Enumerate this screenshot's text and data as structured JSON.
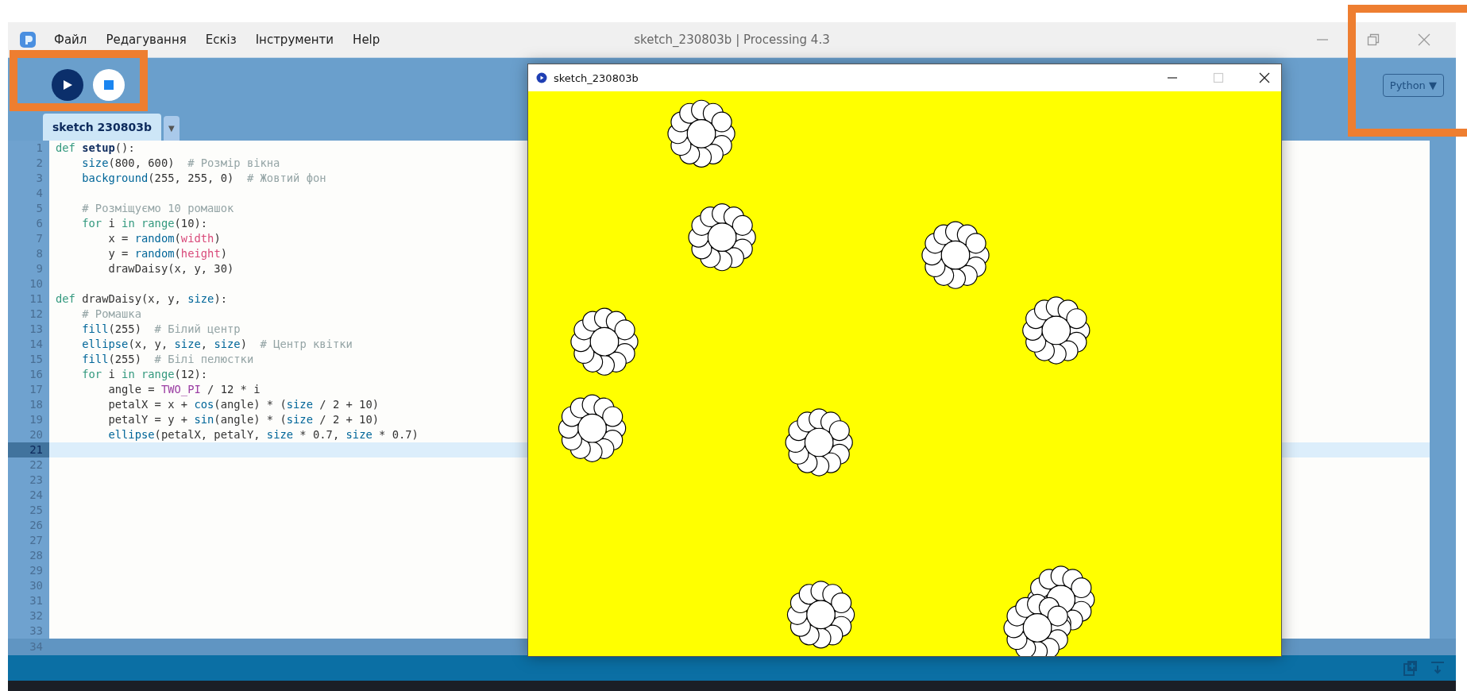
{
  "menu": {
    "items": [
      {
        "label": "Файл"
      },
      {
        "label": "Редагування"
      },
      {
        "label": "Ескіз"
      },
      {
        "label": "Інструменти"
      },
      {
        "label": "Help"
      }
    ]
  },
  "window": {
    "title": "sketch_230803b | Processing 4.3"
  },
  "tabs": [
    {
      "label": "sketch 230803b",
      "selected": true
    }
  ],
  "tab_menu": {
    "label": "▼"
  },
  "mode_button": {
    "label": "Python ▼"
  },
  "editor": {
    "lines": [
      {
        "number": "1",
        "current": false,
        "tokens": [
          {
            "text": "def ",
            "kind": "keyword"
          },
          {
            "text": "setup",
            "kind": "defname"
          },
          {
            "text": "():"
          }
        ]
      },
      {
        "number": "2",
        "current": false,
        "tokens": [
          {
            "text": "    size",
            "kind": "function"
          },
          {
            "text": "(800, 600)  "
          },
          {
            "text": "# Розмір вікна",
            "kind": "comment"
          }
        ]
      },
      {
        "number": "3",
        "current": false,
        "tokens": [
          {
            "text": "    background",
            "kind": "function"
          },
          {
            "text": "(255, 255, 0)  "
          },
          {
            "text": "# Жовтий фон",
            "kind": "comment"
          }
        ]
      },
      {
        "number": "4",
        "current": false
      },
      {
        "number": "5",
        "current": false,
        "tokens": [
          {
            "text": "    # Розміщуємо 10 ромашок",
            "kind": "comment"
          }
        ]
      },
      {
        "number": "6",
        "current": false,
        "tokens": [
          {
            "text": "    for",
            "kind": "keyword"
          },
          {
            "text": " i "
          },
          {
            "text": "in range",
            "kind": "keyword"
          },
          {
            "text": "(10):"
          }
        ]
      },
      {
        "number": "7",
        "current": false,
        "tokens": [
          {
            "text": "        x = "
          },
          {
            "text": "random",
            "kind": "function"
          },
          {
            "text": "("
          },
          {
            "text": "width",
            "kind": "variable"
          },
          {
            "text": ")"
          }
        ]
      },
      {
        "number": "8",
        "current": false,
        "tokens": [
          {
            "text": "        y = "
          },
          {
            "text": "random",
            "kind": "function"
          },
          {
            "text": "("
          },
          {
            "text": "height",
            "kind": "variable"
          },
          {
            "text": ")"
          }
        ]
      },
      {
        "number": "9",
        "current": false,
        "tokens": [
          {
            "text": "        drawDaisy(x, y, 30)"
          }
        ]
      },
      {
        "number": "10",
        "current": false
      },
      {
        "number": "11",
        "current": false,
        "tokens": [
          {
            "text": "def",
            "kind": "keyword"
          },
          {
            "text": " drawDaisy(x, y, "
          },
          {
            "text": "size",
            "kind": "function"
          },
          {
            "text": "):"
          }
        ]
      },
      {
        "number": "12",
        "current": false,
        "tokens": [
          {
            "text": "    # Ромашка",
            "kind": "comment"
          }
        ]
      },
      {
        "number": "13",
        "current": false,
        "tokens": [
          {
            "text": "    fill",
            "kind": "function"
          },
          {
            "text": "(255)  "
          },
          {
            "text": "# Білий центр",
            "kind": "comment"
          }
        ]
      },
      {
        "number": "14",
        "current": false,
        "tokens": [
          {
            "text": "    ellipse",
            "kind": "function"
          },
          {
            "text": "(x, y, "
          },
          {
            "text": "size",
            "kind": "function"
          },
          {
            "text": ", "
          },
          {
            "text": "size",
            "kind": "function"
          },
          {
            "text": ")  "
          },
          {
            "text": "# Центр квітки",
            "kind": "comment"
          }
        ]
      },
      {
        "number": "15",
        "current": false,
        "tokens": [
          {
            "text": "    fill",
            "kind": "function"
          },
          {
            "text": "(255)  "
          },
          {
            "text": "# Білі пелюстки",
            "kind": "comment"
          }
        ]
      },
      {
        "number": "16",
        "current": false,
        "tokens": [
          {
            "text": "    for",
            "kind": "keyword"
          },
          {
            "text": " i "
          },
          {
            "text": "in range",
            "kind": "keyword"
          },
          {
            "text": "(12):"
          }
        ]
      },
      {
        "number": "17",
        "current": false,
        "tokens": [
          {
            "text": "        angle = "
          },
          {
            "text": "TWO_PI",
            "kind": "constant"
          },
          {
            "text": " / 12 * i"
          }
        ]
      },
      {
        "number": "18",
        "current": false,
        "tokens": [
          {
            "text": "        petalX = x + "
          },
          {
            "text": "cos",
            "kind": "function"
          },
          {
            "text": "(angle) * ("
          },
          {
            "text": "size",
            "kind": "function"
          },
          {
            "text": " / 2 + 10)"
          }
        ]
      },
      {
        "number": "19",
        "current": false,
        "tokens": [
          {
            "text": "        petalY = y + "
          },
          {
            "text": "sin",
            "kind": "function"
          },
          {
            "text": "(angle) * ("
          },
          {
            "text": "size",
            "kind": "function"
          },
          {
            "text": " / 2 + 10)"
          }
        ]
      },
      {
        "number": "20",
        "current": false,
        "tokens": [
          {
            "text": "        ellipse",
            "kind": "function"
          },
          {
            "text": "(petalX, petalY, "
          },
          {
            "text": "size",
            "kind": "function"
          },
          {
            "text": " * 0.7, "
          },
          {
            "text": "size",
            "kind": "function"
          },
          {
            "text": " * 0.7)"
          }
        ]
      },
      {
        "number": "21",
        "current": true
      },
      {
        "number": "22",
        "current": false
      },
      {
        "number": "23",
        "current": false
      },
      {
        "number": "24",
        "current": false
      },
      {
        "number": "25",
        "current": false
      },
      {
        "number": "26",
        "current": false
      },
      {
        "number": "27",
        "current": false
      },
      {
        "number": "28",
        "current": false
      },
      {
        "number": "29",
        "current": false
      },
      {
        "number": "30",
        "current": false
      },
      {
        "number": "31",
        "current": false
      },
      {
        "number": "32",
        "current": false
      },
      {
        "number": "33",
        "current": false
      },
      {
        "number": "34",
        "current": false
      }
    ]
  },
  "sketch_window": {
    "title": "sketch_230803b"
  }
}
